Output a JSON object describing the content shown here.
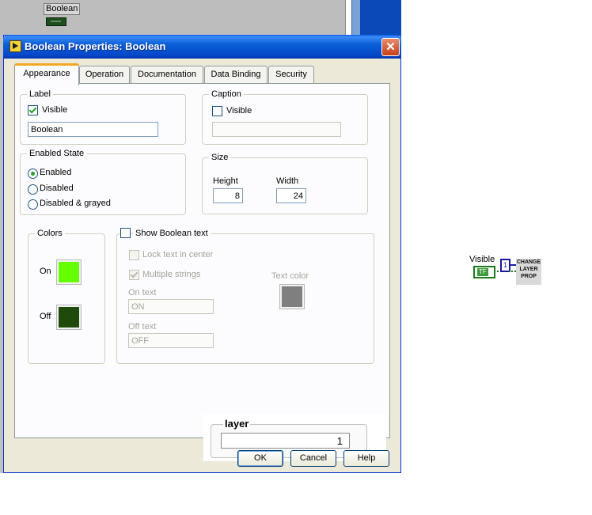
{
  "front_panel": {
    "boolean_label": "Boolean"
  },
  "dialog": {
    "title": "Boolean Properties: Boolean",
    "tabs": [
      "Appearance",
      "Operation",
      "Documentation",
      "Data Binding",
      "Security"
    ],
    "active_tab": "Appearance",
    "label_group": {
      "title": "Label",
      "visible_label": "Visible",
      "visible_checked": true,
      "text_value": "Boolean"
    },
    "caption_group": {
      "title": "Caption",
      "visible_label": "Visible",
      "visible_checked": false,
      "text_value": ""
    },
    "enabled_state": {
      "title": "Enabled State",
      "options": [
        "Enabled",
        "Disabled",
        "Disabled & grayed"
      ],
      "selected": "Enabled"
    },
    "size": {
      "title": "Size",
      "height_label": "Height",
      "height_value": "8",
      "width_label": "Width",
      "width_value": "24"
    },
    "colors": {
      "title": "Colors",
      "on_label": "On",
      "on_color": "#66ff00",
      "off_label": "Off",
      "off_color": "#1f4a0c"
    },
    "boolean_text": {
      "show_label": "Show Boolean text",
      "show_checked": false,
      "lock_label": "Lock text in center",
      "lock_checked": false,
      "multiple_label": "Multiple strings",
      "multiple_checked": true,
      "on_text_label": "On text",
      "on_text_value": "ON",
      "off_text_label": "Off text",
      "off_text_value": "OFF",
      "text_color_label": "Text color",
      "text_color": "#7f7f7f"
    },
    "layer_control": {
      "label": "layer",
      "value": "1"
    },
    "buttons": {
      "ok": "OK",
      "cancel": "Cancel",
      "help": "Help"
    },
    "close_glyph": "✕"
  },
  "block_diagram": {
    "visible_label": "Visible",
    "bool_terminal": "TF",
    "constant_value": "1",
    "subvi_label": "CHANGE LAYER PROP"
  }
}
